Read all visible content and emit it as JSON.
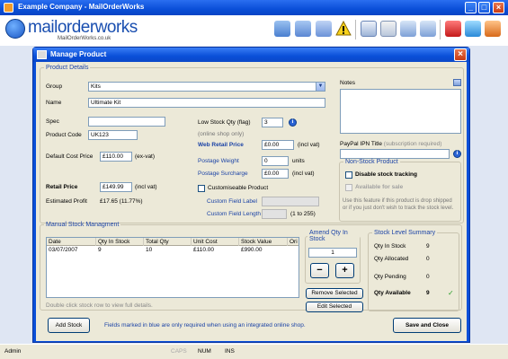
{
  "window": {
    "title": "Example Company - MailOrderWorks"
  },
  "brand": {
    "logo_text": "mailorderworks",
    "logo_sub": "MailOrderWorks.co.uk"
  },
  "toolbar": {
    "icons": [
      "customers-icon",
      "orders-icon",
      "products-icon",
      "warning-icon",
      "reports-icon",
      "edit-icon",
      "add-icon",
      "remove-icon",
      "gift-icon",
      "stats-icon",
      "users-icon"
    ]
  },
  "dialog": {
    "title": "Manage Product",
    "product_details": {
      "legend": "Product Details",
      "group_label": "Group",
      "group_value": "Kits",
      "name_label": "Name",
      "name_value": "Ultimate Kit",
      "spec_label": "Spec",
      "spec_value": "",
      "code_label": "Product Code",
      "code_value": "UK123",
      "default_cost_label": "Default Cost Price",
      "default_cost_value": "£110.00",
      "default_cost_suffix": "(ex-vat)",
      "retail_price_label": "Retail Price",
      "retail_price_value": "£149.99",
      "retail_price_suffix": "(incl vat)",
      "estimated_profit_label": "Estimated Profit",
      "estimated_profit_value": "£17.65 (11.77%)",
      "low_stock_label": "Low Stock Qty (flag)",
      "low_stock_value": "3",
      "online_only_note": "(online shop only)",
      "web_retail_label": "Web Retail Price",
      "web_retail_value": "£0.00",
      "web_retail_suffix": "(incl vat)",
      "postage_weight_label": "Postage Weight",
      "postage_weight_value": "0",
      "postage_weight_suffix": "units",
      "postage_surcharge_label": "Postage Surcharge",
      "postage_surcharge_value": "£0.00",
      "postage_surcharge_suffix": "(incl vat)",
      "customisable_label": "Customiseable Product",
      "custom_field_label_label": "Custom Field Label",
      "custom_field_length_label": "Custom Field Length",
      "custom_field_length_range": "(1 to 255)",
      "notes_label": "Notes",
      "paypal_label": "PayPal IPN Title",
      "paypal_hint": "(subscription required)"
    },
    "non_stock": {
      "legend": "Non-Stock Product",
      "disable_label": "Disable stock tracking",
      "available_label": "Available for sale",
      "help_text_1": "Use this feature if this product is drop shipped",
      "help_text_2": "or if you just don't wish to track the stock level."
    },
    "manual_stock": {
      "legend": "Manual Stock Managment",
      "columns": [
        "Date",
        "Qty In Stock",
        "Total Qty",
        "Unit Cost",
        "Stock Value",
        "Ori"
      ],
      "rows": [
        [
          "03/07/2007",
          "9",
          "10",
          "£110.00",
          "£990.00",
          ""
        ]
      ],
      "hint": "Double click stock row to view full details."
    },
    "amend": {
      "legend": "Amend Qty In Stock",
      "qty_value": "1",
      "minus_label": "−",
      "plus_label": "+",
      "remove_label": "Remove Selected",
      "edit_label": "Edit Selected"
    },
    "summary": {
      "legend": "Stock Level Summary",
      "in_stock_label": "Qty In Stock",
      "in_stock_value": "9",
      "allocated_label": "Qty Allocated",
      "allocated_value": "0",
      "pending_label": "Qty Pending",
      "pending_value": "0",
      "available_label": "Qty Available",
      "available_value": "9",
      "available_tick": "✓"
    },
    "footer": {
      "add_stock_label": "Add Stock",
      "note": "Fields marked in blue are only required when using an integrated online shop.",
      "save_close_label": "Save and Close"
    }
  },
  "statusbar": {
    "user": "Admin",
    "caps": "CAPS",
    "num": "NUM",
    "ins": "INS"
  }
}
